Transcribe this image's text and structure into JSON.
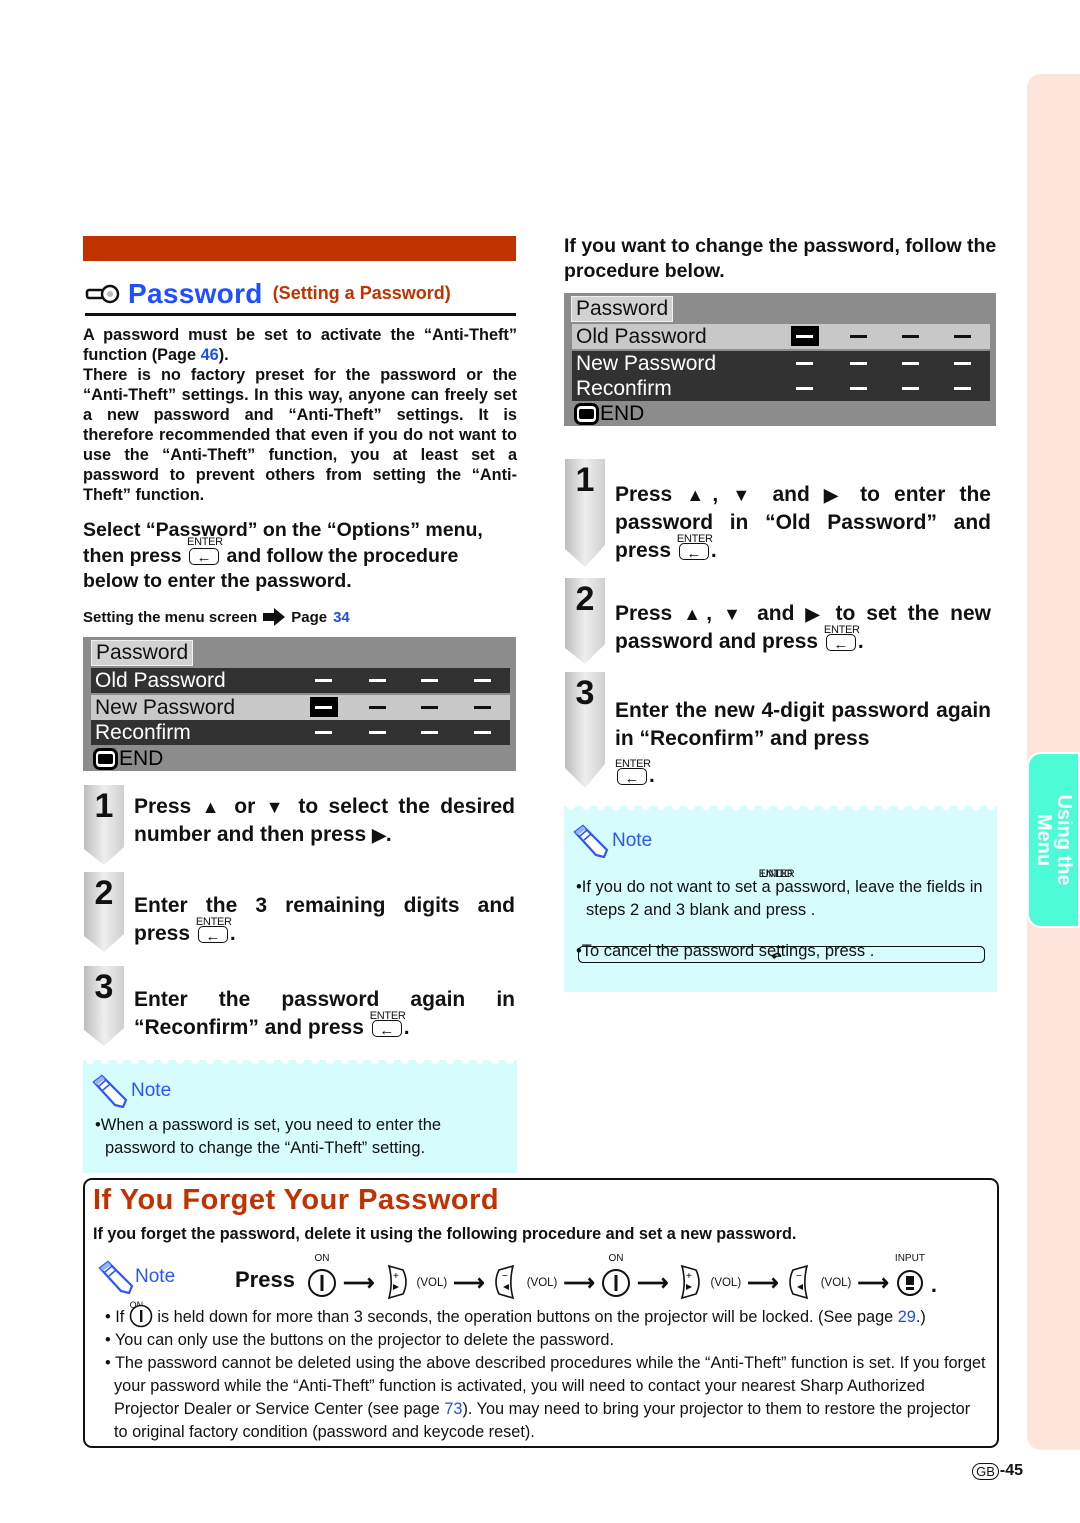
{
  "side_tab": {
    "label_line1": "Using the",
    "label_line2": "Menu",
    "color": "#4dfcd6",
    "strip_color": "#fde5dc"
  },
  "section": {
    "title": "Password",
    "subtitle": "(Setting a Password)",
    "accent_red": "#c03200",
    "accent_blue": "#1f4fff",
    "intro_1a": "A password must be set to activate the “Anti-Theft” function (Page ",
    "intro_1_link": "46",
    "intro_1b": ").",
    "intro_2": "There is no factory preset for the password or the “Anti-Theft” settings. In this way, anyone can freely set a new password and “Anti-Theft” settings. It is therefore recommended that even if you do not want to use the “Anti-Theft” function, you at least set a password to prevent others from setting the “Anti-Theft” function.",
    "lead_a": "Select “Password” on the “Options” menu, then press",
    "lead_b": "and follow the procedure below to enter the password.",
    "menu_ref_label": "Setting the menu screen",
    "menu_ref_page_prefix": "Page",
    "menu_ref_page": "34"
  },
  "enter_key_label": "ENTER",
  "undo_key_label": "UNDO",
  "osd_left": {
    "title": "Password",
    "rows": [
      {
        "label": "Old Password",
        "state": "dark"
      },
      {
        "label": "New Password",
        "state": "selected"
      },
      {
        "label": "Reconfirm",
        "state": "dark"
      }
    ],
    "end_label": "END"
  },
  "osd_right": {
    "title": "Password",
    "rows": [
      {
        "label": "Old Password",
        "state": "selected"
      },
      {
        "label": "New Password",
        "state": "dark"
      },
      {
        "label": "Reconfirm",
        "state": "dark"
      }
    ],
    "end_label": "END"
  },
  "steps_left": [
    {
      "num": "1",
      "text_a": "Press",
      "text_b": "or",
      "text_c": "to select the desired number and then press",
      "text_d": "."
    },
    {
      "num": "2",
      "text_a": "Enter the 3 remaining digits and press",
      "text_b": "."
    },
    {
      "num": "3",
      "text_a": "Enter the password again in “Reconfirm” and press",
      "text_b": "."
    }
  ],
  "note_left": {
    "heading": "Note",
    "items": [
      "When a password is set, you need to enter the password to change the “Anti-Theft” setting."
    ]
  },
  "right": {
    "lead": "If you want to change the password, follow the procedure below."
  },
  "steps_right": [
    {
      "num": "1",
      "text_a": "Press",
      "text_b": "and",
      "text_c": "to enter the password in “Old Password” and press",
      "text_d": "."
    },
    {
      "num": "2",
      "text_a": "Press",
      "text_b": "and",
      "text_c": "to set the new password and press",
      "text_d": "."
    },
    {
      "num": "3",
      "text_a": "Enter the new 4-digit password again in “Reconfirm” and press",
      "text_b": "."
    }
  ],
  "note_right": {
    "heading": "Note",
    "item1_a": "If you do not want to set a password, leave the fields in steps 2 and 3 blank and press",
    "item1_b": ".",
    "item2_a": "To cancel the password settings, press",
    "item2_b": "."
  },
  "forget": {
    "title": "If You Forget Your Password",
    "intro": "If you forget the password, delete it using the following procedure and set a new password.",
    "note_label": "Note",
    "press_label": "Press",
    "on_label": "ON",
    "vol_label": "(VOL)",
    "input_label": "INPUT",
    "end_dot": ".",
    "bullet1_a": "If",
    "bullet1_b": "is held down for more than 3 seconds, the operation buttons on the projector will be locked. (See page ",
    "bullet1_link": "29",
    "bullet1_c": ".)",
    "bullet2": "You can only use the buttons on the projector to delete the password.",
    "bullet3_a": "The password cannot be deleted using the above described procedures while the “Anti-Theft” function is set. If you forget your password while the “Anti-Theft” function is activated, you will need to contact your nearest Sharp Authorized Projector Dealer or Service Center (see page ",
    "bullet3_link": "73",
    "bullet3_b": ").  You may need to bring your projector to them to restore the projector to original factory condition (password and keycode reset)."
  },
  "page_number": {
    "region": "GB",
    "number": "-45"
  }
}
